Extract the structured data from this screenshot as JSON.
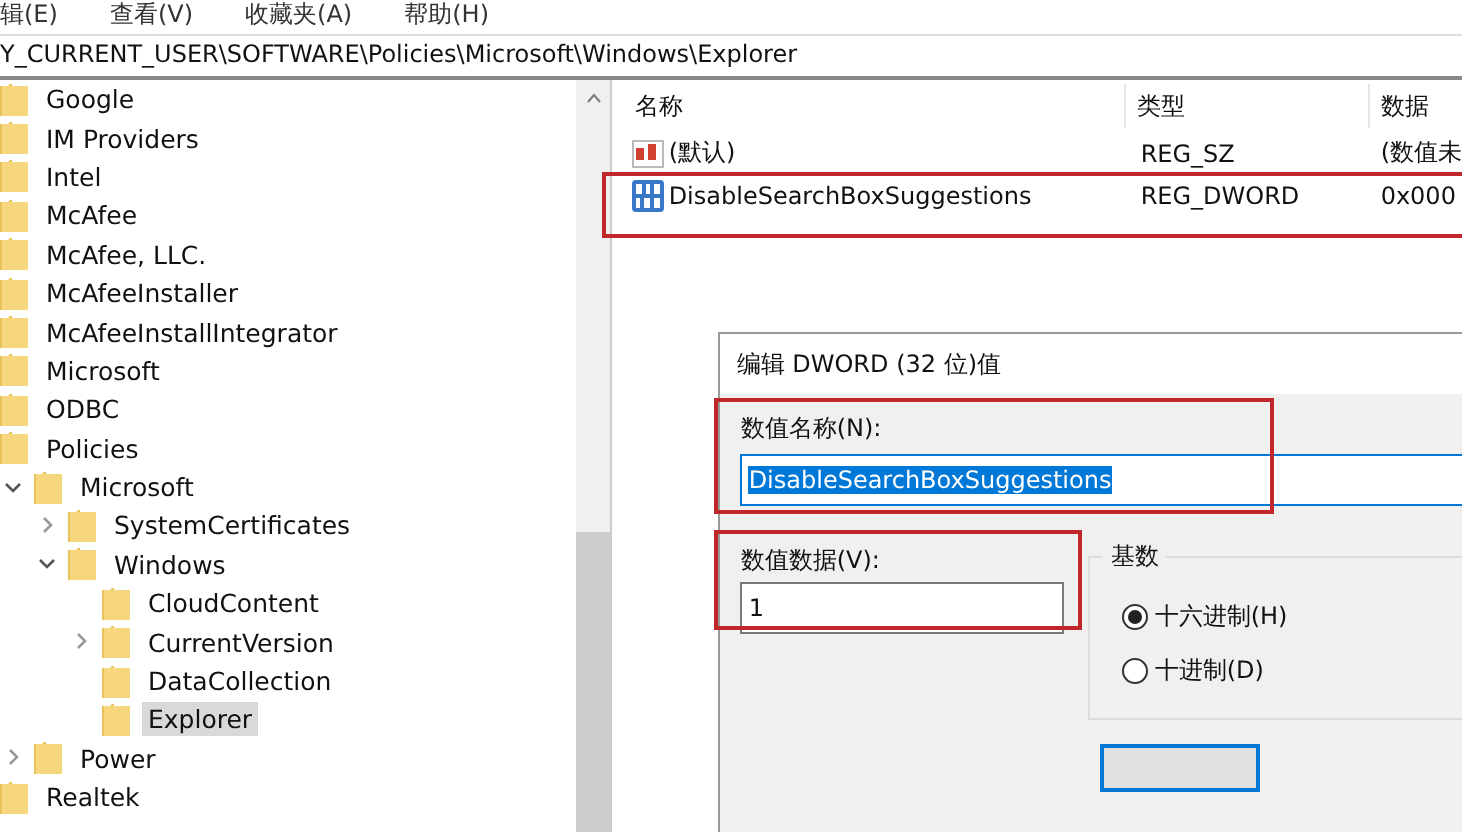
{
  "menu": [
    "辑(E)",
    "查看(V)",
    "收藏夹(A)",
    "帮助(H)"
  ],
  "address": "Y_CURRENT_USER\\SOFTWARE\\Policies\\Microsoft\\Windows\\Explorer",
  "tree": [
    {
      "label": "Google",
      "selected": false
    },
    {
      "label": "IM Providers",
      "selected": false
    },
    {
      "label": "Intel",
      "selected": false
    },
    {
      "label": "McAfee",
      "selected": false
    },
    {
      "label": "McAfee, LLC.",
      "selected": false
    },
    {
      "label": "McAfeeInstaller",
      "selected": false
    },
    {
      "label": "McAfeeInstallIntegrator",
      "selected": false
    },
    {
      "label": "Microsoft",
      "selected": false
    },
    {
      "label": "ODBC",
      "selected": false
    },
    {
      "label": "Policies",
      "selected": false,
      "children": [
        {
          "label": "Microsoft",
          "selected": false,
          "expanded": true,
          "children": [
            {
              "label": "SystemCertificates",
              "selected": false,
              "expanded": false
            },
            {
              "label": "Windows",
              "selected": false,
              "expanded": true,
              "children": [
                {
                  "label": "CloudContent",
                  "selected": false
                },
                {
                  "label": "CurrentVersion",
                  "selected": false,
                  "expanded": false
                },
                {
                  "label": "DataCollection",
                  "selected": false
                },
                {
                  "label": "Explorer",
                  "selected": true
                }
              ]
            }
          ]
        },
        {
          "label": "Power",
          "selected": false,
          "expanded": false
        }
      ]
    },
    {
      "label": "Realtek",
      "selected": false
    }
  ],
  "columns": [
    "名称",
    "类型",
    "数据"
  ],
  "values": [
    {
      "kind": "string",
      "name": "(默认)",
      "type": "REG_SZ",
      "data": "(数值未",
      "highlighted": false
    },
    {
      "kind": "dword",
      "name": "DisableSearchBoxSuggestions",
      "type": "REG_DWORD",
      "data": "0x000",
      "highlighted": true
    }
  ],
  "dialog": {
    "title": "编辑 DWORD (32 位)值",
    "name_label": "数值名称(N):",
    "name_value": "DisableSearchBoxSuggestions",
    "name_highlighted": true,
    "data_label": "数值数据(V):",
    "data_value": "1",
    "data_highlighted": true,
    "base_title": "基数",
    "bases": [
      {
        "label": "十六进制(H)",
        "selected": true
      },
      {
        "label": "十进制(D)",
        "selected": false
      }
    ]
  }
}
